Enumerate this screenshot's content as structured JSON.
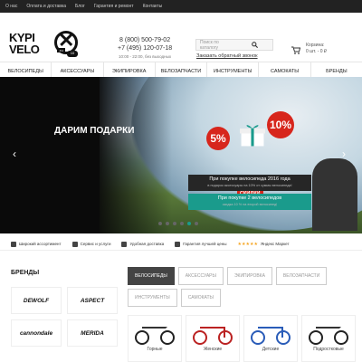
{
  "topbar": {
    "links": [
      "О нас",
      "Оплата и доставка",
      "Блог",
      "Гарантия и ремонт",
      "Контакты"
    ]
  },
  "header": {
    "logo": {
      "line1": "KYPI",
      "line2": "VELO",
      "ru": ".ru",
      "badge": "10"
    },
    "phone1": "8 (800) 500-79-02",
    "phone2": "+7 (495) 120-07-18",
    "hours": "10:00 - 22:00, без выходных",
    "search_placeholder": "Поиск по каталогу",
    "callback": "Заказать обратный звонок",
    "cart_title": "Корзина:",
    "cart_value": "0 шт. - 0 ₽"
  },
  "nav": [
    "ВЕЛОСИПЕДЫ",
    "АКСЕССУАРЫ",
    "ЭКИПИРОВКА",
    "ВЕЛОЗАПЧАСТИ",
    "ИНСТРУМЕНТЫ",
    "САМОКАТЫ",
    "БРЕНДЫ"
  ],
  "hero": {
    "title": "ДАРИМ ПОДАРКИ",
    "skidki": "СКИДКИ",
    "pct1": "5%",
    "pct2": "10%",
    "promo1": "При покупке велосипеда 2016 года",
    "promo1_small": "в подарок аксессуары на 10% от суммы велосипеда!",
    "promo2": "При покупке 2 велосипедов",
    "promo2_small": "скидка 10 % на второй велосипед!",
    "active_dot": 4
  },
  "features": [
    "Широкий ассортимент",
    "Сервис и услуги",
    "Удобная доставка",
    "Гарантия лучшей цены",
    "Яндекс Маркет"
  ],
  "brands": {
    "title": "БРЕНДЫ",
    "items": [
      "DEWOLF",
      "ASPECT",
      "cannondale",
      "MERIDA"
    ]
  },
  "tabs": {
    "row1": [
      "ВЕЛОСИПЕДЫ",
      "АКСЕССУАРЫ",
      "ЭКИПИРОВКА",
      "ВЕЛОЗАПЧАСТИ"
    ],
    "row2": [
      "ИНСТРУМЕНТЫ",
      "САМОКАТЫ"
    ]
  },
  "products": [
    "Горные",
    "Женские",
    "Детские",
    "Подростковые"
  ],
  "colors": {
    "accent": "#1a9b8c",
    "red": "#d7261c",
    "topbar": "#222222"
  }
}
